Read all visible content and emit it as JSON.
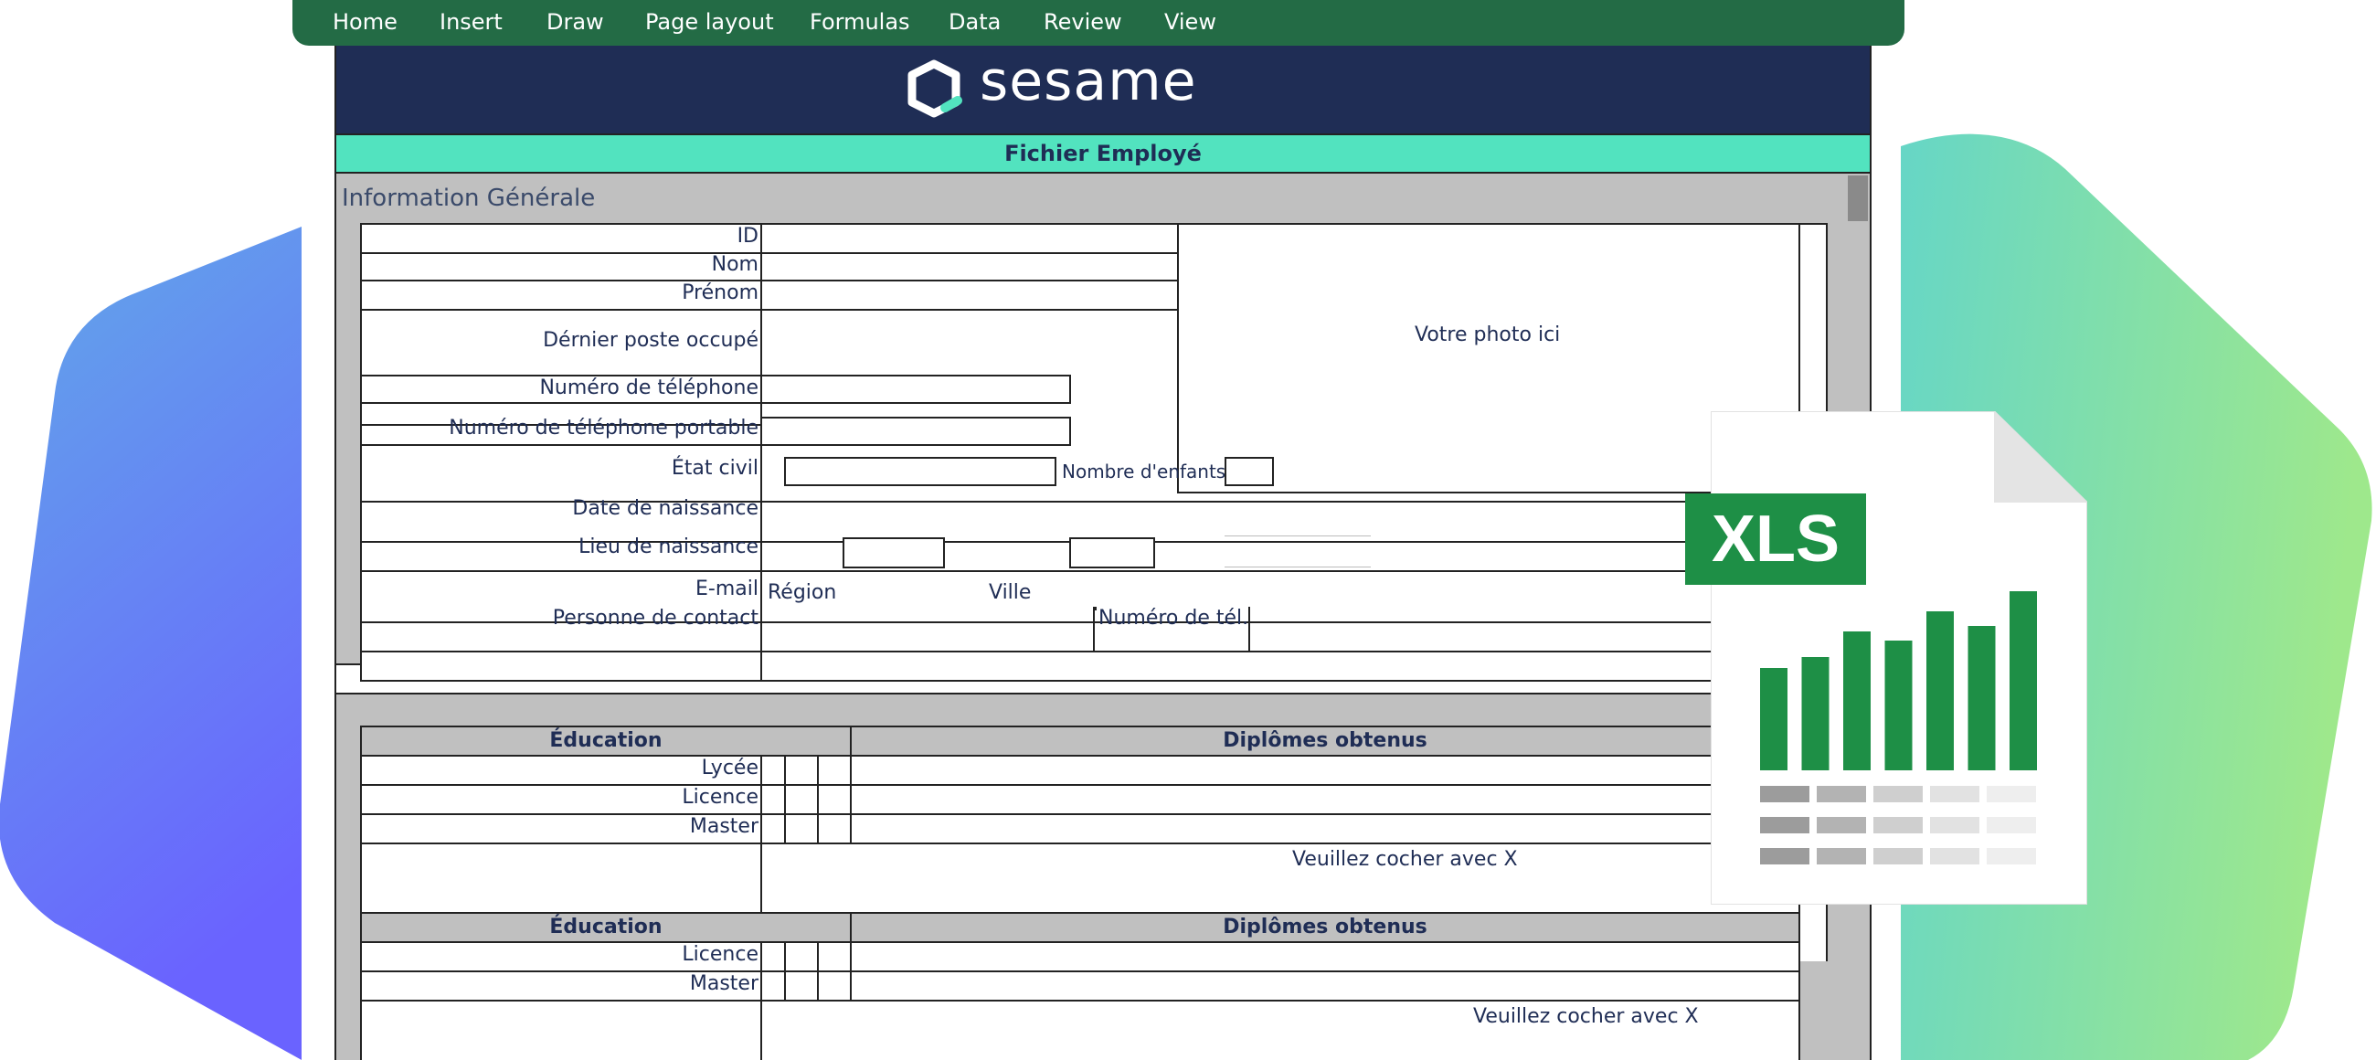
{
  "menu": [
    "Home",
    "Insert",
    "Draw",
    "Page layout",
    "Formulas",
    "Data",
    "Review",
    "View"
  ],
  "brand": {
    "logo_text": "sesame"
  },
  "sheet": {
    "title": "Fichier Employé",
    "section_general": "Information Générale",
    "fields": {
      "id": "ID",
      "nom": "Nom",
      "prenom": "Prénom",
      "dernier_poste": "Dérnier poste occupé",
      "telephone": "Numéro de téléphone",
      "telephone_portable": "Numéro de téléphone portable",
      "etat_civil": "État civil",
      "nombre_enfants": "Nombre d'enfants",
      "date_naissance": "Date de naissance",
      "lieu_naissance": "Lieu de naissance",
      "region": "Région",
      "ville": "Ville",
      "email": "E-mail",
      "personne_contact": "Personne de contact",
      "numero_tel": "Numéro de tél."
    },
    "photo_placeholder": "Votre photo ici",
    "education_table_1": {
      "header_education": "Éducation",
      "header_diplomes": "Diplômes obtenus",
      "rows": [
        "Lycée",
        "Licence",
        "Master"
      ],
      "note": "Veuillez cocher avec X"
    },
    "education_table_2": {
      "header_education": "Éducation",
      "header_diplomes": "Diplômes obtenus",
      "rows": [
        "Licence",
        "Master"
      ],
      "note": "Veuillez cocher avec X"
    }
  },
  "file_icon": {
    "badge": "XLS",
    "bars": [
      0.56,
      0.62,
      0.76,
      0.71,
      0.87,
      0.79,
      0.98
    ]
  },
  "colors": {
    "ribbon": "#236b45",
    "brand_bar": "#1f2d55",
    "title_bar": "#52e3bf",
    "accent_green": "#1e8f46"
  }
}
